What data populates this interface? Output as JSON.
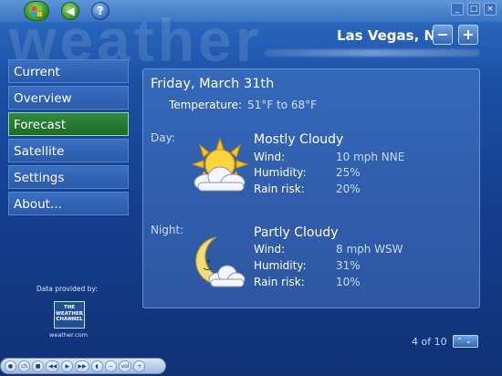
{
  "app": {
    "watermark": "weather",
    "location": "Las Vegas, NV",
    "loc_minus": "−",
    "loc_plus": "+"
  },
  "window_controls": [
    "_",
    "□",
    "×"
  ],
  "menu": {
    "items": [
      {
        "label": "Current",
        "active": false
      },
      {
        "label": "Overview",
        "active": false
      },
      {
        "label": "Forecast",
        "active": true
      },
      {
        "label": "Satellite",
        "active": false
      },
      {
        "label": "Settings",
        "active": false
      },
      {
        "label": "About...",
        "active": false
      }
    ]
  },
  "provider": {
    "label": "Data provided by:",
    "logo_text": "THE WEATHER CHANNEL",
    "url": "weather.com"
  },
  "forecast": {
    "date": "Friday, March 31th",
    "temperature_label": "Temperature:",
    "temperature_value": "51°F to 68°F",
    "day": {
      "label": "Day:",
      "condition": "Mostly Cloudy",
      "wind_label": "Wind:",
      "wind_value": "10 mph NNE",
      "humidity_label": "Humidity:",
      "humidity_value": "25%",
      "rain_label": "Rain risk:",
      "rain_value": "20%",
      "icon": "sun-cloud-icon"
    },
    "night": {
      "label": "Night:",
      "condition": "Partly Cloudy",
      "wind_label": "Wind:",
      "wind_value": "8 mph WSW",
      "humidity_label": "Humidity:",
      "humidity_value": "31%",
      "rain_label": "Rain risk:",
      "rain_value": "10%",
      "icon": "moon-cloud-icon"
    }
  },
  "pager": {
    "text": "4 of 10",
    "arrows": "⌃⌄"
  },
  "transport": {
    "ch_label": "ch",
    "vol_label": "vol"
  },
  "colors": {
    "active_menu": "#1d6b29",
    "menu": "#2b5aa8",
    "background": "#143f8e"
  }
}
